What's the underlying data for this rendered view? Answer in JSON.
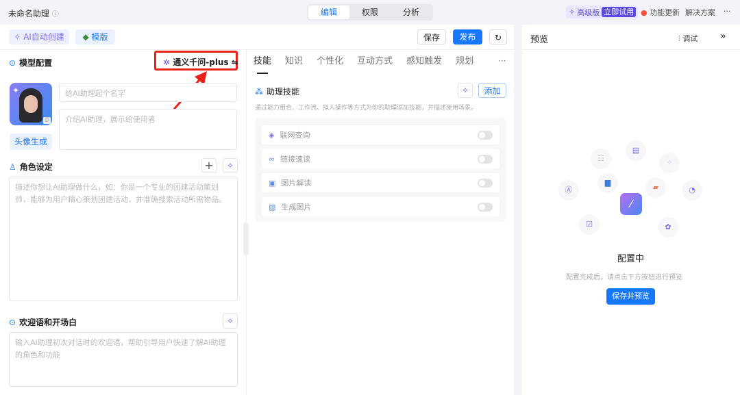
{
  "topbar": {
    "title": "未命名助理",
    "tabs": [
      "编辑",
      "权限",
      "分析"
    ],
    "pro_label": "高级版",
    "pro_badge": "立即试用",
    "updates": "功能更新",
    "solutions": "解决方案",
    "more": "···"
  },
  "toolbar": {
    "ai_create": "AI自动创建",
    "template": "模版",
    "save": "保存",
    "publish": "发布"
  },
  "model": {
    "label": "模型配置",
    "selected": "通义千问-plus"
  },
  "profile": {
    "name_placeholder": "给AI助理起个名字",
    "intro_placeholder": "介绍AI助理，展示给使用者",
    "avatar_gen": "头像生成"
  },
  "role": {
    "label": "角色设定",
    "placeholder": "描述你想让AI助理做什么，如：你是一个专业的团建活动策划师，能够为用户精心策划团建活动，并准确搜索活动所需物品。"
  },
  "welcome": {
    "label": "欢迎语和开场白",
    "placeholder": "输入AI助理初次对话时的欢迎语，帮助引导用户快速了解AI助理的角色和功能"
  },
  "tabs": [
    "技能",
    "知识",
    "个性化",
    "互动方式",
    "感知触发",
    "规划"
  ],
  "skills": {
    "label": "助理技能",
    "add": "添加",
    "desc": "通过能力组合、工作流、拟人操作等方式为你的助理添加技能，并描述使用场景。",
    "items": [
      {
        "label": "联网查询",
        "icon": "wifi-icon",
        "enabled": false
      },
      {
        "label": "链接速读",
        "icon": "link-icon",
        "enabled": false
      },
      {
        "label": "图片解读",
        "icon": "image-scan-icon",
        "enabled": false
      },
      {
        "label": "生成图片",
        "icon": "image-icon",
        "enabled": false
      }
    ]
  },
  "preview": {
    "title": "预览",
    "debug": "调试",
    "status": "配置中",
    "hint": "配置完成后，请点击下方按钮进行预览",
    "button": "保存并预览"
  },
  "colors": {
    "accent": "#1677ff",
    "pro": "#5b4bdb",
    "highlight": "#e8221a"
  }
}
